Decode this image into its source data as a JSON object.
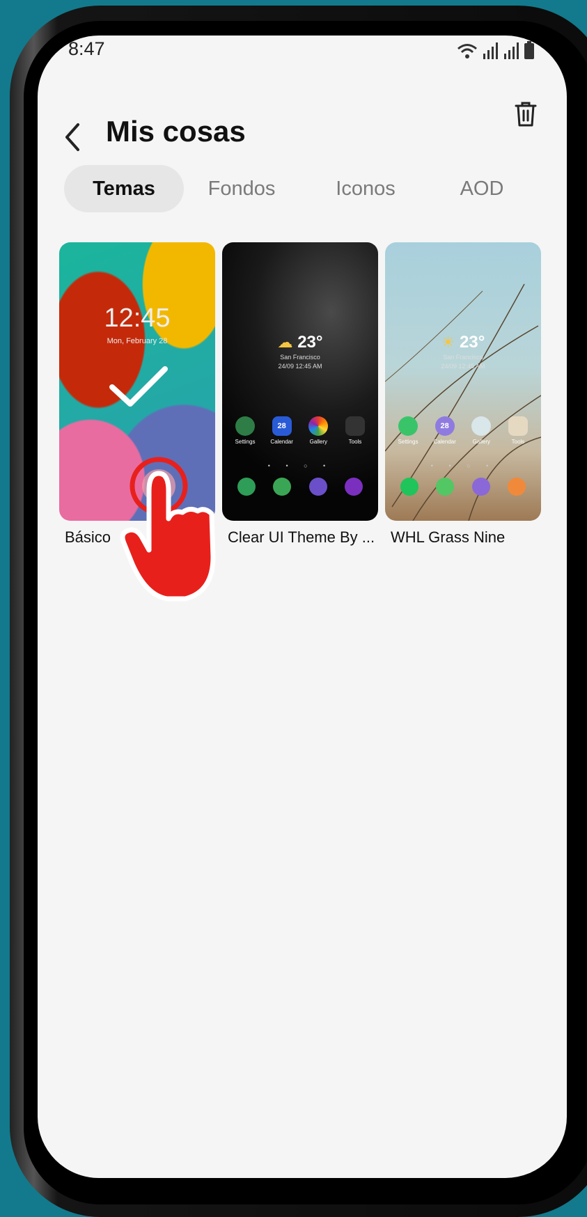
{
  "status_bar": {
    "time": "8:47"
  },
  "header": {
    "title": "Mis cosas"
  },
  "tabs": [
    {
      "label": "Temas",
      "active": true
    },
    {
      "label": "Fondos",
      "active": false
    },
    {
      "label": "Iconos",
      "active": false
    },
    {
      "label": "AOD",
      "active": false
    }
  ],
  "themes": [
    {
      "name": "Básico",
      "selected": true,
      "preview": {
        "time": "12:45",
        "date": "Mon, February 28"
      }
    },
    {
      "name": "Clear UI Theme By ...",
      "selected": false,
      "preview": {
        "temp": "23°",
        "city": "San Francisco",
        "datetime": "24/09 12:45 AM",
        "apps": [
          "Settings",
          "Calendar",
          "Gallery",
          "Tools"
        ],
        "calendar_day": "28"
      }
    },
    {
      "name": "WHL Grass Nine",
      "selected": false,
      "preview": {
        "temp": "23°",
        "city": "San Francisco",
        "datetime": "24/09 12:45 AM",
        "apps": [
          "Settings",
          "Calendar",
          "Gallery",
          "Tools"
        ],
        "calendar_day": "28"
      }
    }
  ],
  "colors": {
    "background": "#127a8c",
    "screen": "#f5f5f5",
    "active_tab": "#e6e6e6",
    "pointer_hand": "#e8201c"
  }
}
